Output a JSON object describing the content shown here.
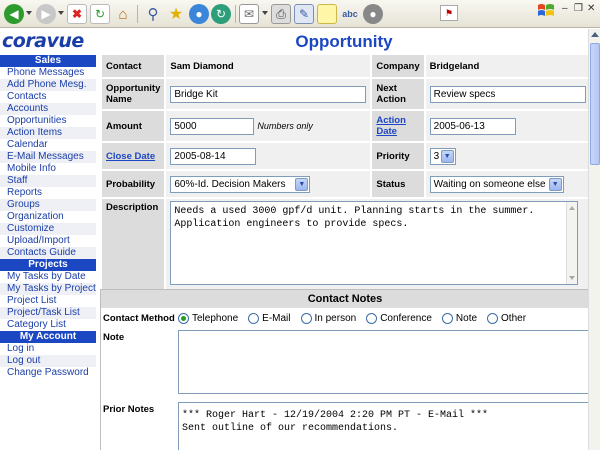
{
  "logo": "coravue",
  "page_title": "Opportunity",
  "sidebar": {
    "sections": [
      {
        "heading": "Sales",
        "items": [
          "Phone Messages",
          "Add Phone Mesg.",
          "Contacts",
          "Accounts",
          "Opportunities",
          "Action Items",
          "Calendar",
          "E-Mail Messages",
          "Mobile Info",
          "Staff",
          "Reports",
          "Groups",
          "Organization",
          "Customize",
          "Upload/Import",
          "Contacts Guide"
        ]
      },
      {
        "heading": "Projects",
        "items": [
          "My Tasks by Date",
          "My Tasks by Project",
          "Project List",
          "Project/Task List",
          "Category List"
        ]
      },
      {
        "heading": "My Account",
        "items": [
          "Log in",
          "Log out",
          "Change Password"
        ]
      }
    ]
  },
  "form": {
    "contact_label": "Contact",
    "contact_value": "Sam Diamond",
    "company_label": "Company",
    "company_value": "Bridgeland",
    "opp_name_label": "Opportunity Name",
    "opp_name_value": "Bridge Kit",
    "next_action_label": "Next Action",
    "next_action_value": "Review specs",
    "amount_label": "Amount",
    "amount_value": "5000",
    "amount_hint": "Numbers only",
    "action_date_label": "Action Date",
    "action_date_value": "2005-06-13",
    "close_date_label": "Close Date",
    "close_date_value": "2005-08-14",
    "priority_label": "Priority",
    "priority_value": "3",
    "probability_label": "Probability",
    "probability_value": "60%-Id. Decision Makers",
    "status_label": "Status",
    "status_value": "Waiting on someone else",
    "description_label": "Description",
    "description_value": "Needs a used 3000 gpf/d unit. Planning starts in the summer.\nApplication engineers to provide specs."
  },
  "notes": {
    "heading": "Contact Notes",
    "method_label": "Contact Method",
    "methods": [
      "Telephone",
      "E-Mail",
      "In person",
      "Conference",
      "Note",
      "Other"
    ],
    "selected_method": "Telephone",
    "note_label": "Note",
    "prior_label": "Prior Notes",
    "prior_value": "*** Roger Hart - 12/19/2004 2:20 PM PT - E-Mail ***\nSent outline of our recommendations."
  }
}
